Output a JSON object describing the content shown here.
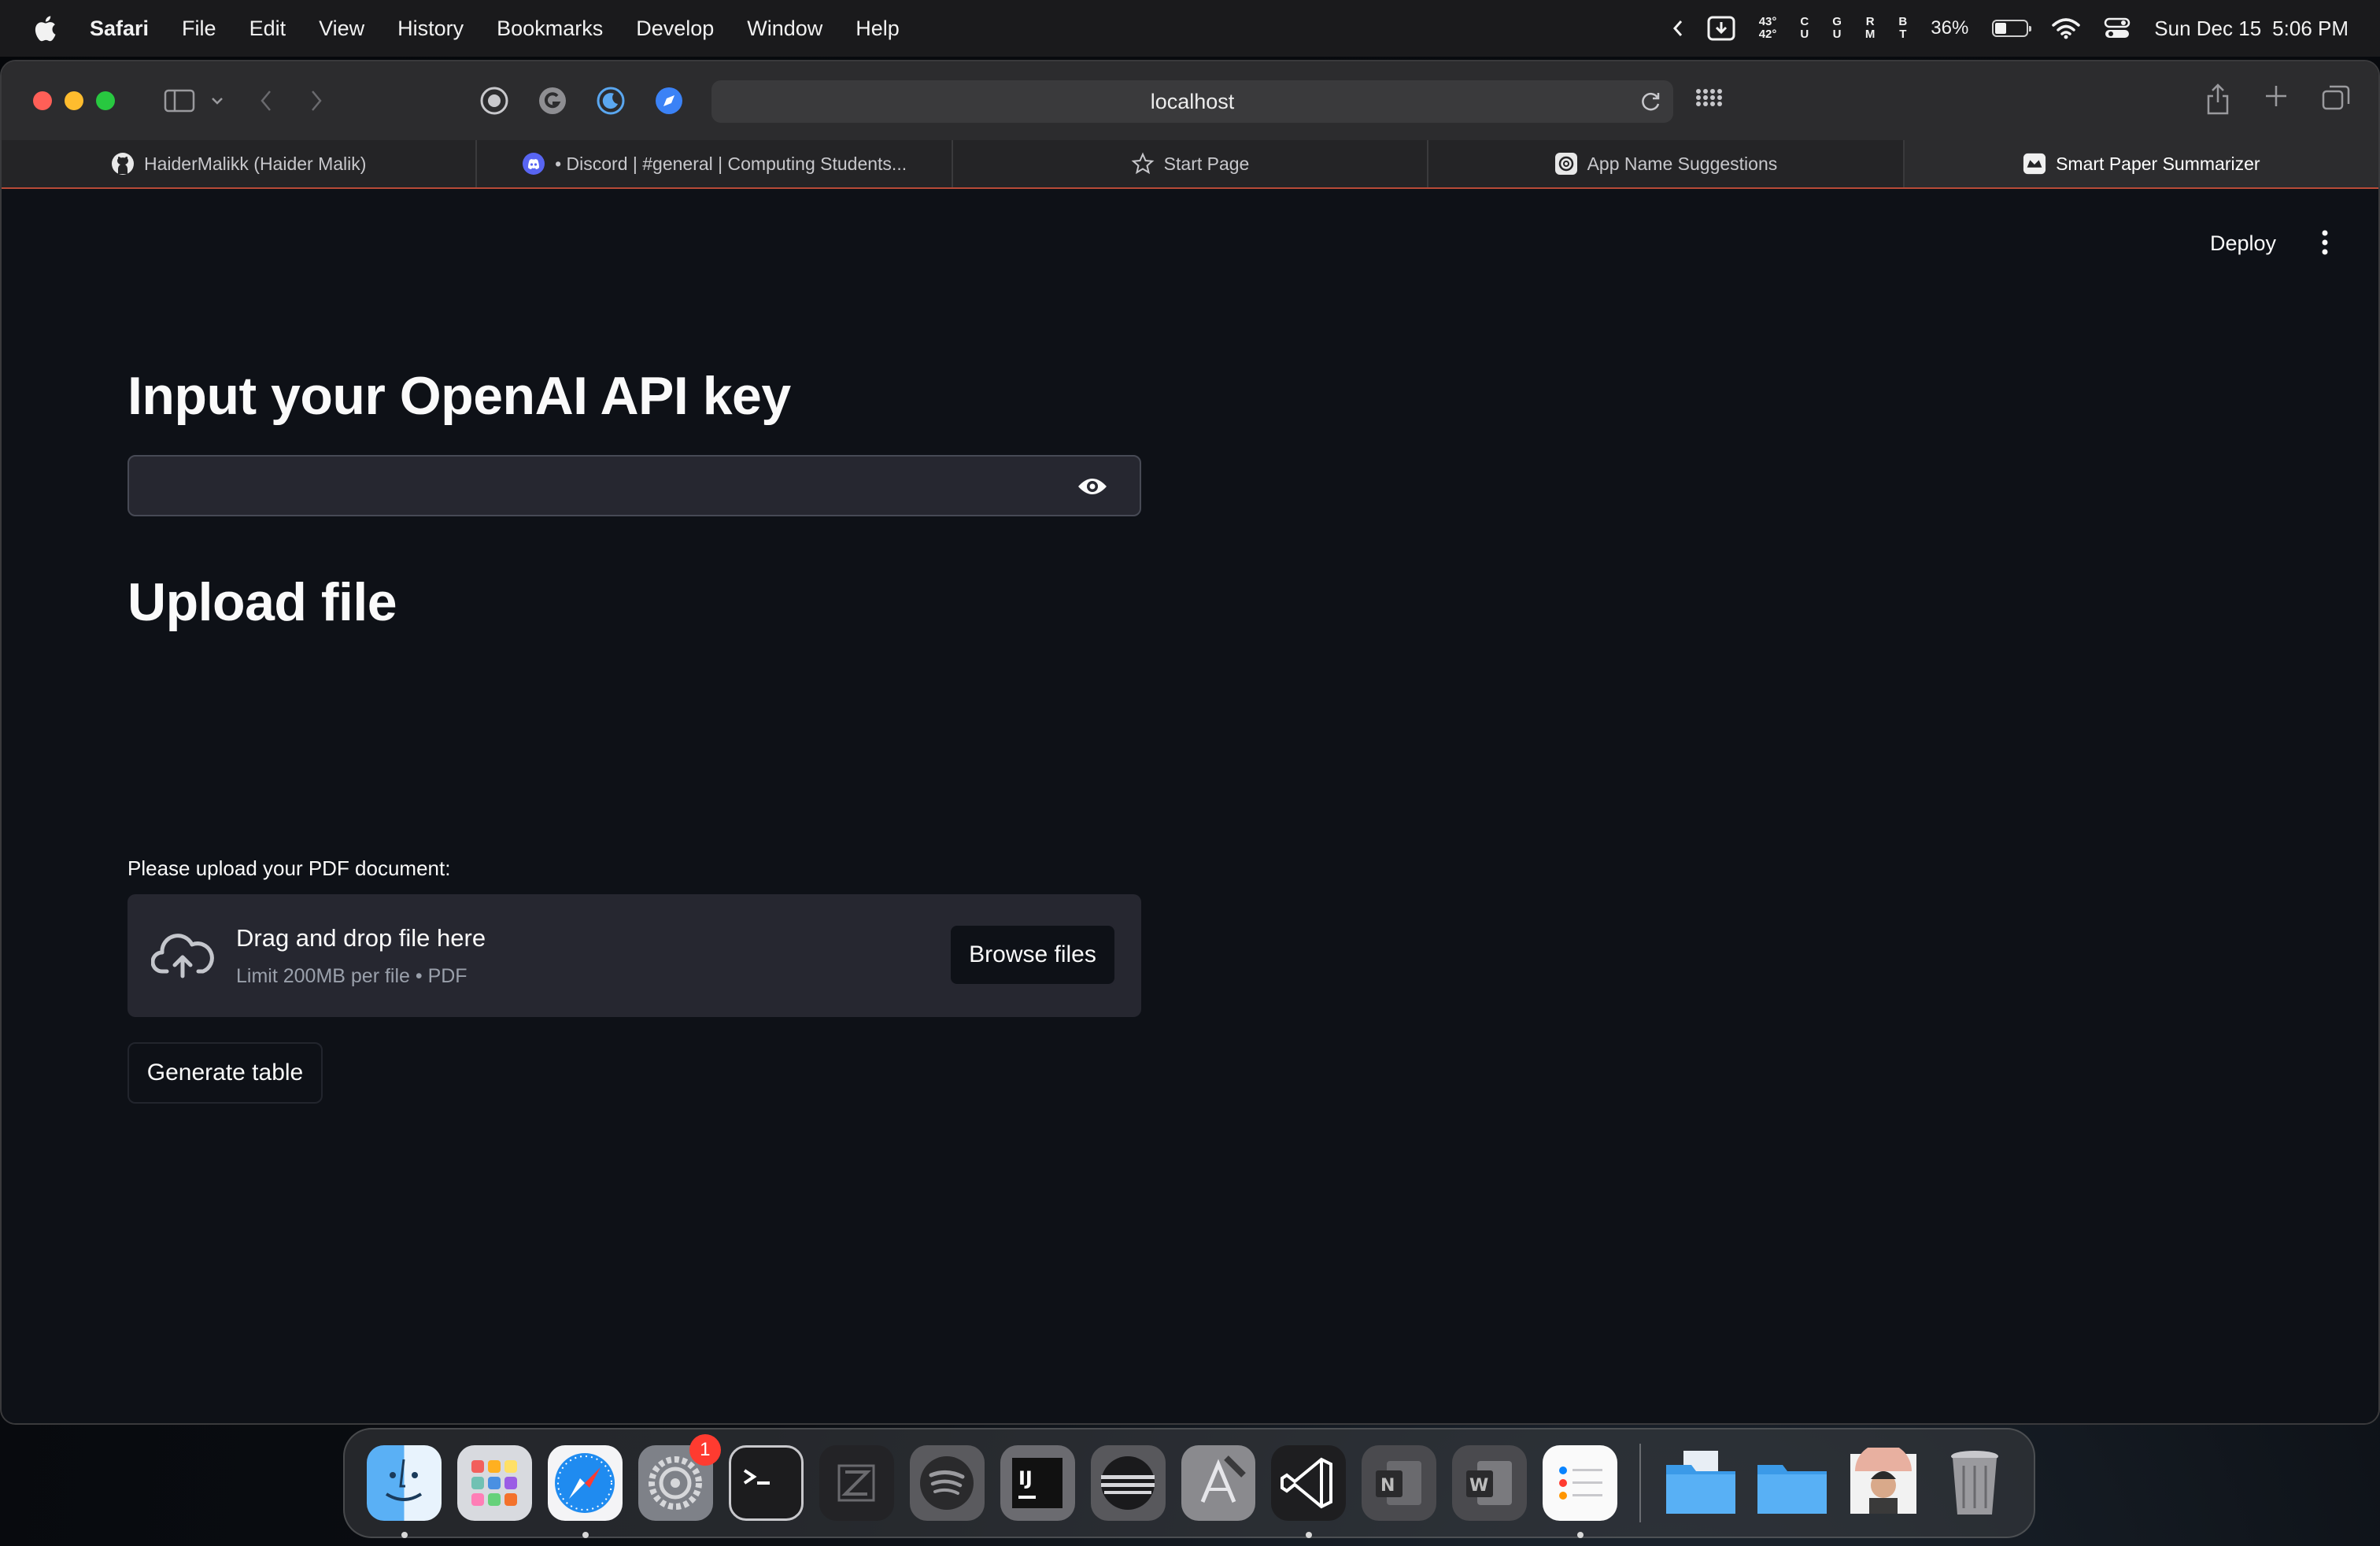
{
  "menubar": {
    "app_name": "Safari",
    "items": [
      "File",
      "Edit",
      "View",
      "History",
      "Bookmarks",
      "Develop",
      "Window",
      "Help"
    ],
    "weather_hi": "43°",
    "weather_lo": "42°",
    "cpu_label_a": "C",
    "cpu_label_b": "U",
    "gpu_label_a": "G",
    "gpu_label_b": "U",
    "ram_label_a": "R",
    "ram_label_b": "M",
    "bat_label_a": "B",
    "bat_label_b": "T",
    "battery_percent": "36%",
    "battery_level": 0.36,
    "date": "Sun Dec 15",
    "time": "5:06 PM"
  },
  "browser": {
    "url": "localhost",
    "tabs": [
      {
        "label": "HaiderMalikk (Haider Malik)",
        "icon": "github-icon"
      },
      {
        "label": "• Discord | #general | Computing Students...",
        "icon": "discord-icon"
      },
      {
        "label": "Start Page",
        "icon": "star-icon"
      },
      {
        "label": "App Name Suggestions",
        "icon": "openai-icon"
      },
      {
        "label": "Smart Paper Summarizer",
        "icon": "streamlit-icon"
      }
    ],
    "active_tab": 4
  },
  "app": {
    "deploy_label": "Deploy",
    "api_heading": "Input your OpenAI API key",
    "api_value": "",
    "upload_heading": "Upload file",
    "upload_label": "Please upload your PDF document:",
    "drop_title": "Drag and drop file here",
    "drop_subtitle": "Limit 200MB per file • PDF",
    "browse_label": "Browse files",
    "generate_label": "Generate table"
  },
  "dock": {
    "apps": [
      {
        "name": "Finder",
        "icon": "finder-icon",
        "running": true
      },
      {
        "name": "Launchpad",
        "icon": "launchpad-icon",
        "running": false
      },
      {
        "name": "Safari",
        "icon": "safari-icon",
        "running": true
      },
      {
        "name": "System Settings",
        "icon": "settings-icon",
        "running": false,
        "badge": "1"
      },
      {
        "name": "Terminal",
        "icon": "terminal-icon",
        "running": false
      },
      {
        "name": "Zed",
        "icon": "zed-icon",
        "running": false
      },
      {
        "name": "Spotify",
        "icon": "spotify-icon",
        "running": false
      },
      {
        "name": "IntelliJ IDEA",
        "icon": "intellij-icon",
        "running": false
      },
      {
        "name": "Eclipse",
        "icon": "eclipse-icon",
        "running": false
      },
      {
        "name": "Xcode",
        "icon": "xcode-icon",
        "running": false
      },
      {
        "name": "Visual Studio Code",
        "icon": "vscode-icon",
        "running": true
      },
      {
        "name": "OneNote",
        "icon": "onenote-icon",
        "running": false
      },
      {
        "name": "Word",
        "icon": "word-icon",
        "running": false
      },
      {
        "name": "Reminders",
        "icon": "reminders-icon",
        "running": true
      }
    ],
    "stacks": [
      {
        "name": "Folder",
        "icon": "folder-icon"
      },
      {
        "name": "Downloads",
        "icon": "folder-icon"
      },
      {
        "name": "Photo",
        "icon": "photo-icon"
      },
      {
        "name": "Trash",
        "icon": "trash-icon"
      }
    ]
  },
  "colors": {
    "page_bg": "#0e1117",
    "widget_bg": "#262730",
    "tab_accent": "#b84a37"
  }
}
